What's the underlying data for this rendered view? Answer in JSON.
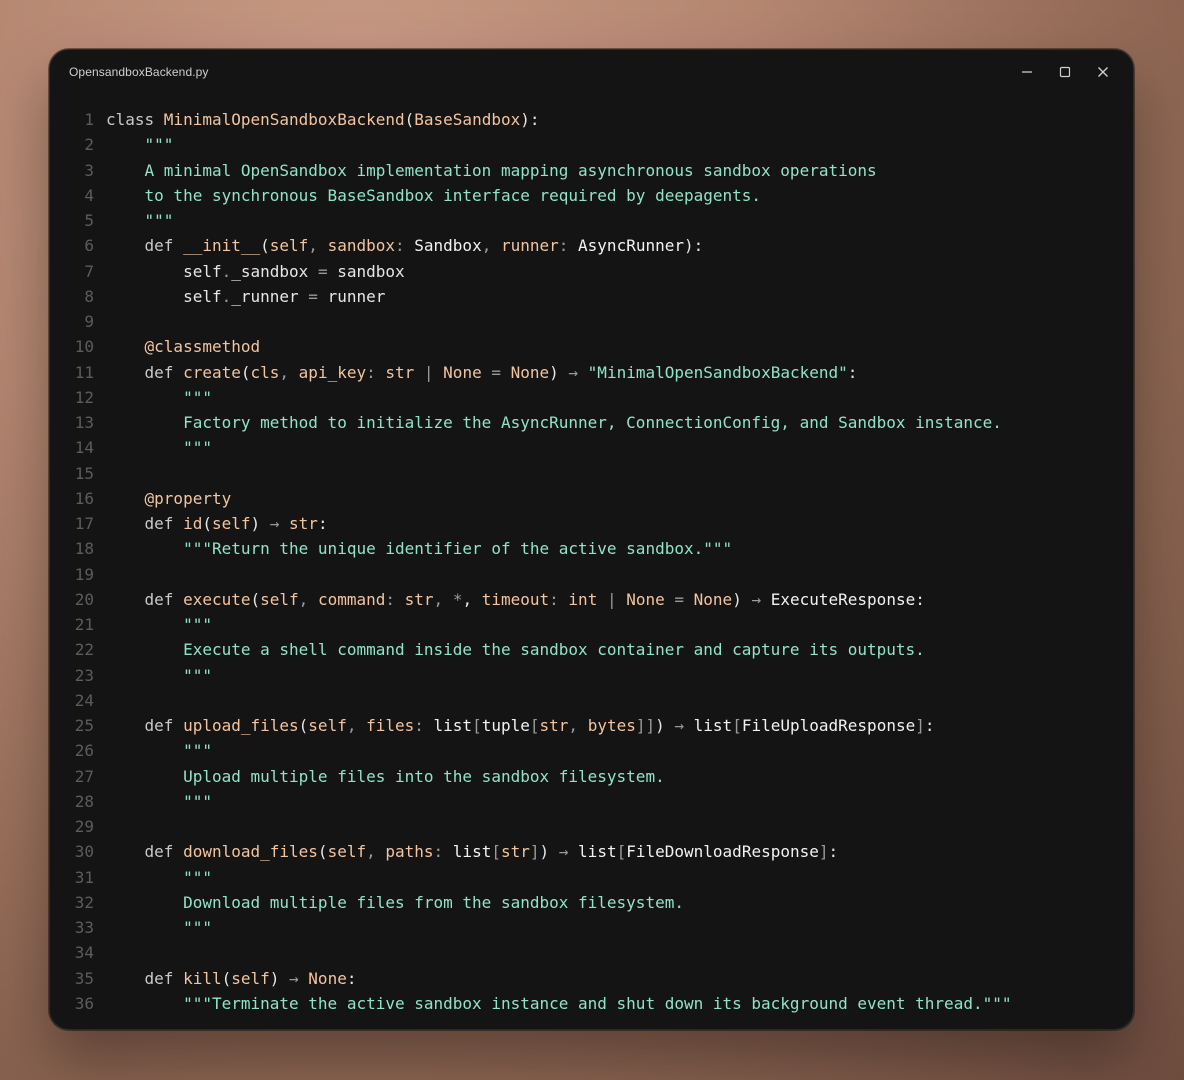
{
  "window": {
    "title": "OpensandboxBackend.py"
  },
  "icons": {
    "minimize": "minimize-icon",
    "maximize": "maximize-icon",
    "close": "close-icon"
  },
  "colors": {
    "window_bg": "#141414",
    "keyword": "#c9c9c9",
    "function": "#f2c59e",
    "docstring": "#8fe3c8",
    "line_number": "#5c5c5c",
    "text": "#e6e6e6"
  },
  "code": {
    "lines": [
      {
        "n": "1",
        "tokens": [
          [
            "kw",
            "class "
          ],
          [
            "cls",
            "MinimalOpenSandboxBackend"
          ],
          [
            "p",
            "("
          ],
          [
            "nm",
            "BaseSandbox"
          ],
          [
            "p",
            "):"
          ]
        ]
      },
      {
        "n": "2",
        "tokens": [
          [
            "doc",
            "    \"\"\""
          ]
        ]
      },
      {
        "n": "3",
        "tokens": [
          [
            "doc",
            "    A minimal OpenSandbox implementation mapping asynchronous sandbox operations"
          ]
        ]
      },
      {
        "n": "4",
        "tokens": [
          [
            "doc",
            "    to the synchronous BaseSandbox interface required by deepagents."
          ]
        ]
      },
      {
        "n": "5",
        "tokens": [
          [
            "doc",
            "    \"\"\""
          ]
        ]
      },
      {
        "n": "6",
        "tokens": [
          [
            "kw",
            "    def "
          ],
          [
            "fn",
            "__init__"
          ],
          [
            "p",
            "("
          ],
          [
            "nm",
            "self"
          ],
          [
            "op",
            ", "
          ],
          [
            "nm",
            "sandbox"
          ],
          [
            "op",
            ": "
          ],
          [
            "ty",
            "Sandbox"
          ],
          [
            "op",
            ", "
          ],
          [
            "nm",
            "runner"
          ],
          [
            "op",
            ": "
          ],
          [
            "ty",
            "AsyncRunner"
          ],
          [
            "p",
            "):"
          ]
        ]
      },
      {
        "n": "7",
        "tokens": [
          [
            "p",
            "        self"
          ],
          [
            "op",
            "."
          ],
          [
            "p",
            "_sandbox "
          ],
          [
            "op",
            "= "
          ],
          [
            "p",
            "sandbox"
          ]
        ]
      },
      {
        "n": "8",
        "tokens": [
          [
            "p",
            "        self"
          ],
          [
            "op",
            "."
          ],
          [
            "p",
            "_runner "
          ],
          [
            "op",
            "= "
          ],
          [
            "p",
            "runner"
          ]
        ]
      },
      {
        "n": "9",
        "tokens": [
          [
            "p",
            ""
          ]
        ]
      },
      {
        "n": "10",
        "tokens": [
          [
            "dec",
            "    @classmethod"
          ]
        ]
      },
      {
        "n": "11",
        "tokens": [
          [
            "kw",
            "    def "
          ],
          [
            "fn",
            "create"
          ],
          [
            "p",
            "("
          ],
          [
            "nm",
            "cls"
          ],
          [
            "op",
            ", "
          ],
          [
            "nm",
            "api_key"
          ],
          [
            "op",
            ": "
          ],
          [
            "nm",
            "str "
          ],
          [
            "op",
            "| "
          ],
          [
            "nm",
            "None "
          ],
          [
            "op",
            "= "
          ],
          [
            "nm",
            "None"
          ],
          [
            "p",
            ") "
          ],
          [
            "op",
            "→ "
          ],
          [
            "str",
            "\"MinimalOpenSandboxBackend\""
          ],
          [
            "p",
            ":"
          ]
        ]
      },
      {
        "n": "12",
        "tokens": [
          [
            "doc",
            "        \"\"\""
          ]
        ]
      },
      {
        "n": "13",
        "tokens": [
          [
            "doc",
            "        Factory method to initialize the AsyncRunner, ConnectionConfig, and Sandbox instance."
          ]
        ]
      },
      {
        "n": "14",
        "tokens": [
          [
            "doc",
            "        \"\"\""
          ]
        ]
      },
      {
        "n": "15",
        "tokens": [
          [
            "p",
            ""
          ]
        ]
      },
      {
        "n": "16",
        "tokens": [
          [
            "dec",
            "    @property"
          ]
        ]
      },
      {
        "n": "17",
        "tokens": [
          [
            "kw",
            "    def "
          ],
          [
            "fn",
            "id"
          ],
          [
            "p",
            "("
          ],
          [
            "nm",
            "self"
          ],
          [
            "p",
            ") "
          ],
          [
            "op",
            "→ "
          ],
          [
            "nm",
            "str"
          ],
          [
            "p",
            ":"
          ]
        ]
      },
      {
        "n": "18",
        "tokens": [
          [
            "doc",
            "        \"\"\"Return the unique identifier of the active sandbox.\"\"\""
          ]
        ]
      },
      {
        "n": "19",
        "tokens": [
          [
            "p",
            ""
          ]
        ]
      },
      {
        "n": "20",
        "tokens": [
          [
            "kw",
            "    def "
          ],
          [
            "fn",
            "execute"
          ],
          [
            "p",
            "("
          ],
          [
            "nm",
            "self"
          ],
          [
            "op",
            ", "
          ],
          [
            "nm",
            "command"
          ],
          [
            "op",
            ": "
          ],
          [
            "nm",
            "str"
          ],
          [
            "op",
            ", "
          ],
          [
            "op",
            "*"
          ],
          [
            "p",
            ", "
          ],
          [
            "nm",
            "timeout"
          ],
          [
            "op",
            ": "
          ],
          [
            "nm",
            "int "
          ],
          [
            "op",
            "| "
          ],
          [
            "nm",
            "None "
          ],
          [
            "op",
            "= "
          ],
          [
            "nm",
            "None"
          ],
          [
            "p",
            ") "
          ],
          [
            "op",
            "→ "
          ],
          [
            "ty",
            "ExecuteResponse"
          ],
          [
            "p",
            ":"
          ]
        ]
      },
      {
        "n": "21",
        "tokens": [
          [
            "doc",
            "        \"\"\""
          ]
        ]
      },
      {
        "n": "22",
        "tokens": [
          [
            "doc",
            "        Execute a shell command inside the sandbox container and capture its outputs."
          ]
        ]
      },
      {
        "n": "23",
        "tokens": [
          [
            "doc",
            "        \"\"\""
          ]
        ]
      },
      {
        "n": "24",
        "tokens": [
          [
            "p",
            ""
          ]
        ]
      },
      {
        "n": "25",
        "tokens": [
          [
            "kw",
            "    def "
          ],
          [
            "fn",
            "upload_files"
          ],
          [
            "p",
            "("
          ],
          [
            "nm",
            "self"
          ],
          [
            "op",
            ", "
          ],
          [
            "nm",
            "files"
          ],
          [
            "op",
            ": "
          ],
          [
            "ty",
            "list"
          ],
          [
            "op",
            "["
          ],
          [
            "ty",
            "tuple"
          ],
          [
            "op",
            "["
          ],
          [
            "nm",
            "str"
          ],
          [
            "op",
            ", "
          ],
          [
            "nm",
            "bytes"
          ],
          [
            "op",
            "]]"
          ],
          [
            "p",
            ") "
          ],
          [
            "op",
            "→ "
          ],
          [
            "ty",
            "list"
          ],
          [
            "op",
            "["
          ],
          [
            "ty",
            "FileUploadResponse"
          ],
          [
            "op",
            "]"
          ],
          [
            "p",
            ":"
          ]
        ]
      },
      {
        "n": "26",
        "tokens": [
          [
            "doc",
            "        \"\"\""
          ]
        ]
      },
      {
        "n": "27",
        "tokens": [
          [
            "doc",
            "        Upload multiple files into the sandbox filesystem."
          ]
        ]
      },
      {
        "n": "28",
        "tokens": [
          [
            "doc",
            "        \"\"\""
          ]
        ]
      },
      {
        "n": "29",
        "tokens": [
          [
            "p",
            ""
          ]
        ]
      },
      {
        "n": "30",
        "tokens": [
          [
            "kw",
            "    def "
          ],
          [
            "fn",
            "download_files"
          ],
          [
            "p",
            "("
          ],
          [
            "nm",
            "self"
          ],
          [
            "op",
            ", "
          ],
          [
            "nm",
            "paths"
          ],
          [
            "op",
            ": "
          ],
          [
            "ty",
            "list"
          ],
          [
            "op",
            "["
          ],
          [
            "nm",
            "str"
          ],
          [
            "op",
            "]"
          ],
          [
            "p",
            ") "
          ],
          [
            "op",
            "→ "
          ],
          [
            "ty",
            "list"
          ],
          [
            "op",
            "["
          ],
          [
            "ty",
            "FileDownloadResponse"
          ],
          [
            "op",
            "]"
          ],
          [
            "p",
            ":"
          ]
        ]
      },
      {
        "n": "31",
        "tokens": [
          [
            "doc",
            "        \"\"\""
          ]
        ]
      },
      {
        "n": "32",
        "tokens": [
          [
            "doc",
            "        Download multiple files from the sandbox filesystem."
          ]
        ]
      },
      {
        "n": "33",
        "tokens": [
          [
            "doc",
            "        \"\"\""
          ]
        ]
      },
      {
        "n": "34",
        "tokens": [
          [
            "p",
            ""
          ]
        ]
      },
      {
        "n": "35",
        "tokens": [
          [
            "kw",
            "    def "
          ],
          [
            "fn",
            "kill"
          ],
          [
            "p",
            "("
          ],
          [
            "nm",
            "self"
          ],
          [
            "p",
            ") "
          ],
          [
            "op",
            "→ "
          ],
          [
            "nm",
            "None"
          ],
          [
            "p",
            ":"
          ]
        ]
      },
      {
        "n": "36",
        "tokens": [
          [
            "doc",
            "        \"\"\"Terminate the active sandbox instance and shut down its background event thread.\"\"\""
          ]
        ]
      }
    ]
  }
}
